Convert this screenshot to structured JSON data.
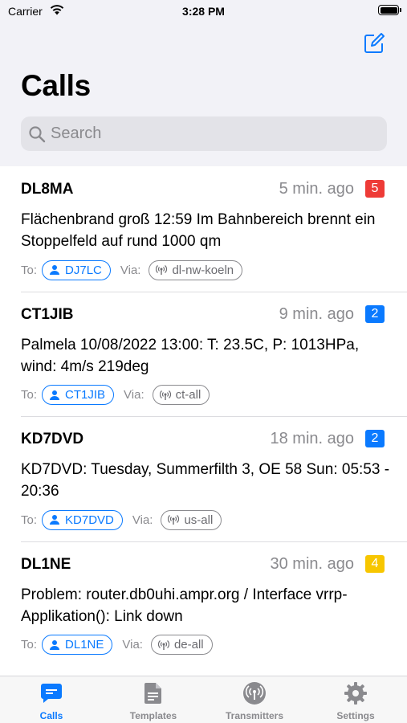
{
  "status_bar": {
    "carrier": "Carrier",
    "time": "3:28 PM"
  },
  "header": {
    "title": "Calls"
  },
  "search": {
    "placeholder": "Search"
  },
  "calls": [
    {
      "callsign": "DL8MA",
      "age": "5 min. ago",
      "badge": "5",
      "badge_color": "#ee3b37",
      "message": "Flächenbrand groß 12:59 Im Bahnbereich brennt ein Stoppelfeld auf rund 1000 qm",
      "to_label": "To:",
      "to": "DJ7LC",
      "via_label": "Via:",
      "via": "dl-nw-koeln"
    },
    {
      "callsign": "CT1JIB",
      "age": "9 min. ago",
      "badge": "2",
      "badge_color": "#0a7aff",
      "message": "Palmela 10/08/2022 13:00: T: 23.5C, P: 1013HPa, wind: 4m/s 219deg",
      "to_label": "To:",
      "to": "CT1JIB",
      "via_label": "Via:",
      "via": "ct-all"
    },
    {
      "callsign": "KD7DVD",
      "age": "18 min. ago",
      "badge": "2",
      "badge_color": "#0a7aff",
      "message": "KD7DVD: Tuesday, Summerfilth 3, OE 58 Sun: 05:53 - 20:36",
      "to_label": "To:",
      "to": "KD7DVD",
      "via_label": "Via:",
      "via": "us-all"
    },
    {
      "callsign": "DL1NE",
      "age": "30 min. ago",
      "badge": "4",
      "badge_color": "#f7c600",
      "message": "Problem: router.db0uhi.ampr.org / Interface vrrp-Applikation(): Link down",
      "to_label": "To:",
      "to": "DL1NE",
      "via_label": "Via:",
      "via": "de-all"
    }
  ],
  "tabs": [
    {
      "label": "Calls",
      "icon": "message-bubble-icon",
      "active": true
    },
    {
      "label": "Templates",
      "icon": "document-icon",
      "active": false
    },
    {
      "label": "Transmitters",
      "icon": "antenna-icon",
      "active": false
    },
    {
      "label": "Settings",
      "icon": "gear-icon",
      "active": false
    }
  ],
  "colors": {
    "accent": "#0a7aff",
    "inactive": "#8a8a8e"
  }
}
